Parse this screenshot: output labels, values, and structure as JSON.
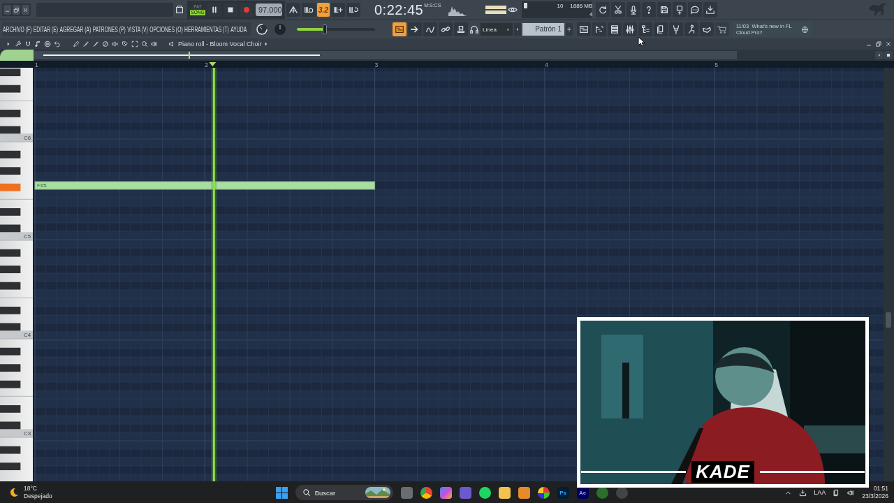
{
  "transport": {
    "modes": [
      {
        "label": "PAT",
        "selected": false
      },
      {
        "label": "SONG",
        "selected": true
      }
    ],
    "playing": true,
    "tempo": "97.000",
    "step_button": {
      "label": "3.2",
      "on": true
    },
    "time": "0:22:45",
    "time_unit": "M:S:CS"
  },
  "monitor": {
    "cpu": "10",
    "memory": "1886 MB",
    "polyphony": "4"
  },
  "menu": [
    "ARCHIVO (F)",
    "EDITAR (E)",
    "AGREGAR (A)",
    "PATRONES (P)",
    "VISTA (V)",
    "OPCIONES (O)",
    "HERRAMIENTAS (T)",
    "AYUDA"
  ],
  "master_volume": {
    "level": 0.38
  },
  "toolbar": {
    "snap": "Línea",
    "pattern": "Patrón 1",
    "news_date": "11/03",
    "news_text": "What's new in FL Cloud Pro?"
  },
  "piano_roll": {
    "title": "Piano roll - Bloom Vocal Choir",
    "bars": [
      "1",
      "2",
      "3",
      "4",
      "5"
    ],
    "octave_labels": [
      "C6",
      "C5",
      "C4",
      "C3"
    ],
    "notes": [
      {
        "label": "F#5",
        "playing": true
      }
    ]
  },
  "webcam": {
    "kind": "picture",
    "caption": "KADE"
  },
  "taskbar": {
    "temperature": "18°C",
    "condition": "Despejado",
    "search_placeholder": "Buscar",
    "app_badges": [
      "Ps",
      "Ae"
    ],
    "input_language": "LAA",
    "time": "01:51",
    "date": "23/3/2026"
  }
}
